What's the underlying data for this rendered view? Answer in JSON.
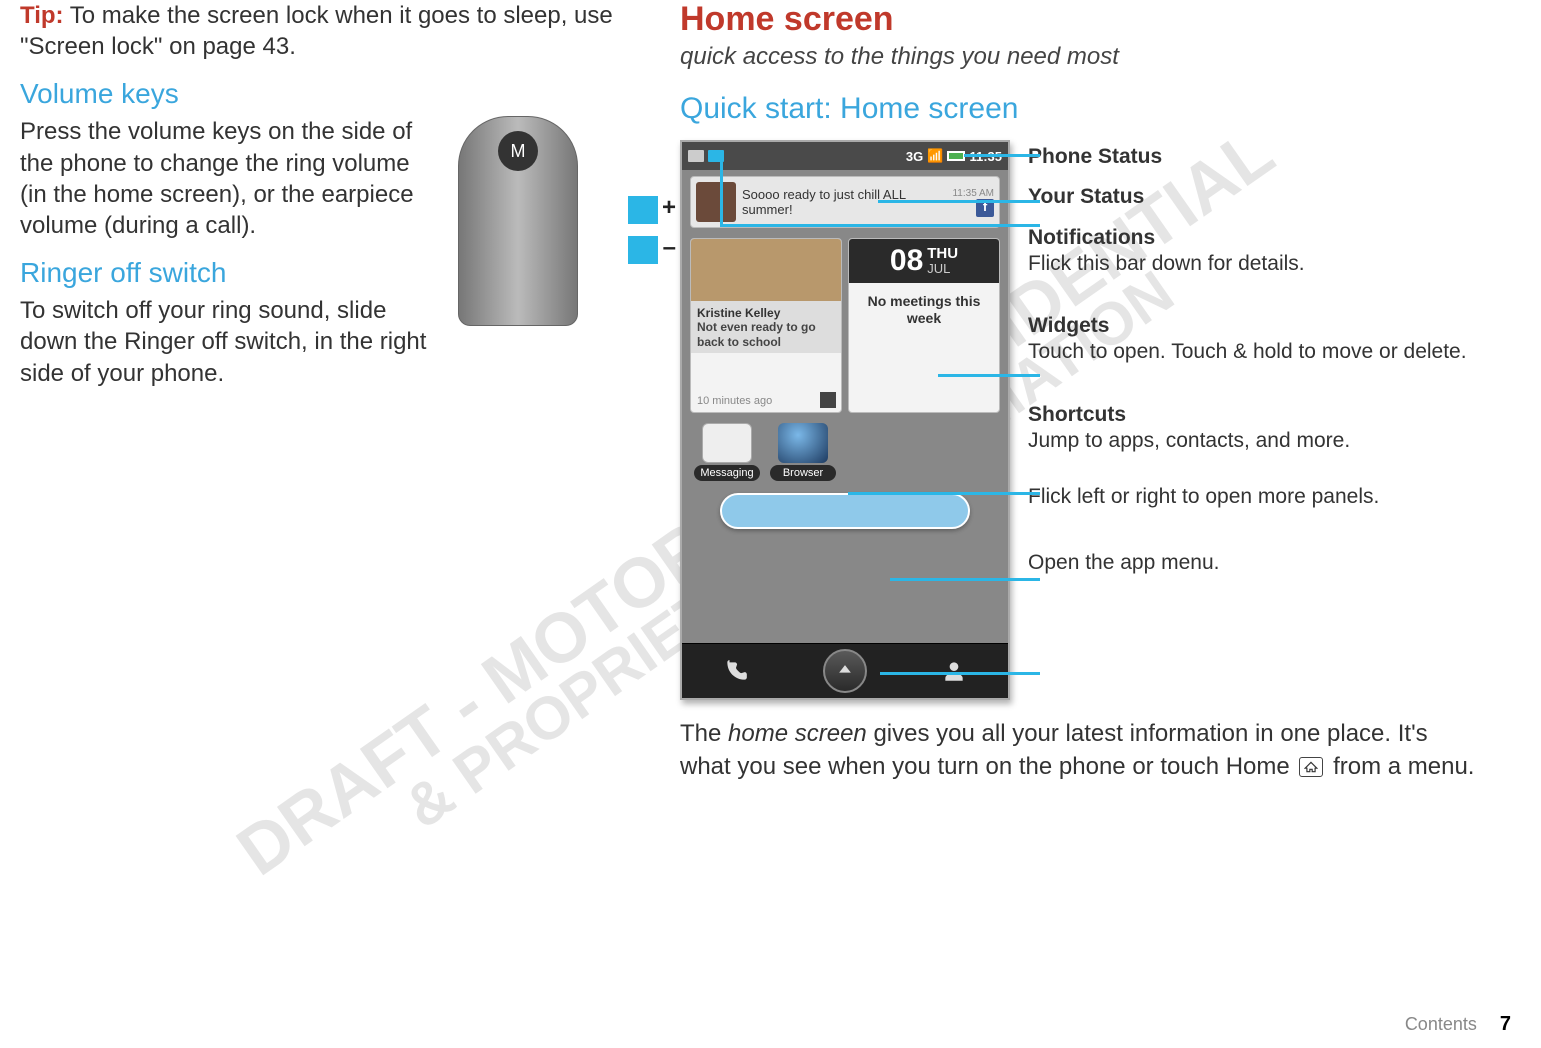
{
  "watermark": {
    "line1": "DRAFT - MOTOROLA CONFIDENTIAL",
    "line2": "& PROPRIETARY INFORMATION"
  },
  "left": {
    "tip_label": "Tip:",
    "tip_text": " To make the screen lock when it goes to sleep, use \"Screen lock\" on page 43.",
    "volume_heading": "Volume keys",
    "volume_body": "Press the volume keys on the side of the phone to change the ring volume (in the home screen), or the earpiece volume (during a call).",
    "ringer_heading": "Ringer off switch",
    "ringer_body": "To switch off your ring sound, slide down the Ringer off switch, in the right side of your phone.",
    "plus": "+",
    "minus": "–"
  },
  "right": {
    "title": "Home screen",
    "subtitle": "quick access to the things you need most",
    "quick_heading": "Quick start: Home screen",
    "phone": {
      "signal": "3G",
      "time": "11:35",
      "status_text": "Soooo ready to just chill ALL summer!",
      "status_time": "11:35 AM",
      "w1_name": "Kristine Kelley",
      "w1_sub": "Not even ready to go back to school",
      "w1_time": "10 minutes ago",
      "w2_day": "08",
      "w2_dow": "THU",
      "w2_month": "JUL",
      "w2_meet": "No meetings this week",
      "sc_msg": "Messaging",
      "sc_browser": "Browser"
    },
    "callouts": {
      "phone_status": "Phone Status",
      "your_status": "Your Status",
      "notif_t": "Notifications",
      "notif_d": "Flick this bar down for details.",
      "widgets_t": "Widgets",
      "widgets_d": "Touch to open. Touch & hold to move or delete.",
      "shortcuts_t": "Shortcuts",
      "shortcuts_d": "Jump to apps, contacts, and more.",
      "panels": "Flick left or right to open more panels.",
      "menu": "Open the app menu."
    },
    "body1a": "The ",
    "body1_term": "home screen",
    "body1b": " gives you all your latest information in one place. It's what you see when you turn on the phone or touch Home ",
    "body1c": " from a menu."
  },
  "footer": {
    "label": "Contents",
    "page": "7"
  }
}
